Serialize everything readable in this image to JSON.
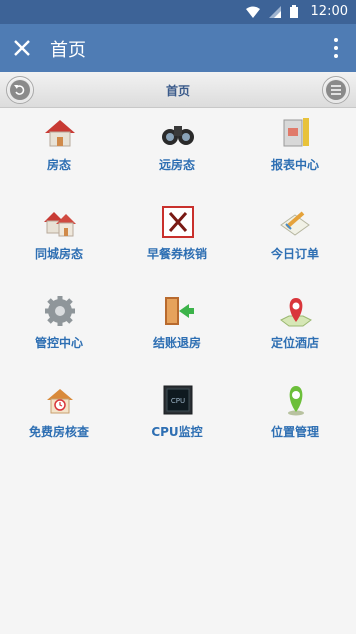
{
  "status": {
    "time": "12:00"
  },
  "app_bar": {
    "title": "首页"
  },
  "sub_header": {
    "title": "首页"
  },
  "tiles": [
    {
      "label": "房态"
    },
    {
      "label": "远房态"
    },
    {
      "label": "报表中心"
    },
    {
      "label": "同城房态"
    },
    {
      "label": "早餐券核销"
    },
    {
      "label": "今日订单"
    },
    {
      "label": "管控中心"
    },
    {
      "label": "结账退房"
    },
    {
      "label": "定位酒店"
    },
    {
      "label": "免费房核查"
    },
    {
      "label": "CPU监控"
    },
    {
      "label": "位置管理"
    }
  ],
  "icons": {
    "tile_0": "house-icon",
    "tile_1": "binoculars-icon",
    "tile_2": "report-icon",
    "tile_3": "houses-icon",
    "tile_4": "fork-knife-icon",
    "tile_5": "notebook-pencil-icon",
    "tile_6": "gear-icon",
    "tile_7": "door-exit-icon",
    "tile_8": "map-pin-icon",
    "tile_9": "house-clock-icon",
    "tile_10": "cpu-icon",
    "tile_11": "location-pin-icon"
  }
}
